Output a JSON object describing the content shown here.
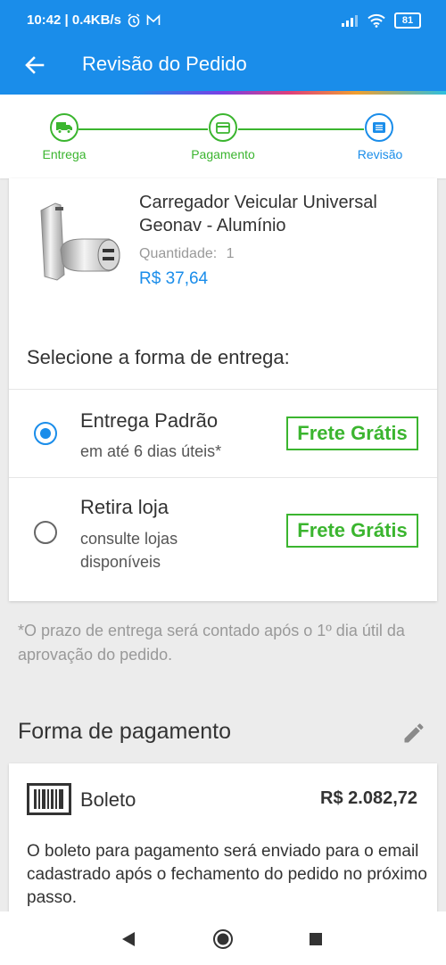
{
  "status_bar": {
    "time_speed": "10:42 | 0.4KB/s",
    "battery": "81"
  },
  "app_bar": {
    "title": "Revisão do Pedido"
  },
  "stepper": {
    "steps": [
      {
        "label": "Entrega",
        "icon": "truck-icon",
        "color": "#3bb52f"
      },
      {
        "label": "Pagamento",
        "icon": "card-icon",
        "color": "#3bb52f"
      },
      {
        "label": "Revisão",
        "icon": "list-icon",
        "color": "#1a8dea"
      }
    ]
  },
  "product": {
    "name": "Carregador Veicular Universal Geonav - Alumínio",
    "quantity_label": "Quantidade:",
    "quantity": "1",
    "price": "R$ 37,64"
  },
  "delivery": {
    "title": "Selecione a forma de entrega:",
    "options": [
      {
        "title": "Entrega Padrão",
        "subtitle": "em até 6 dias úteis*",
        "badge": "Frete Grátis",
        "selected": true
      },
      {
        "title": "Retira loja",
        "subtitle": "consulte lojas disponíveis",
        "badge": "Frete Grátis",
        "selected": false
      }
    ],
    "note": "*O prazo de entrega será contado após o 1º dia útil da aprovação do pedido."
  },
  "payment": {
    "title": "Forma de pagamento",
    "method": "Boleto",
    "amount": "R$ 2.082,72",
    "description": "O boleto para pagamento será enviado para o email cadastrado após o fechamento do pedido no próximo passo."
  },
  "colors": {
    "primary": "#1a8dea",
    "success": "#3bb52f"
  }
}
